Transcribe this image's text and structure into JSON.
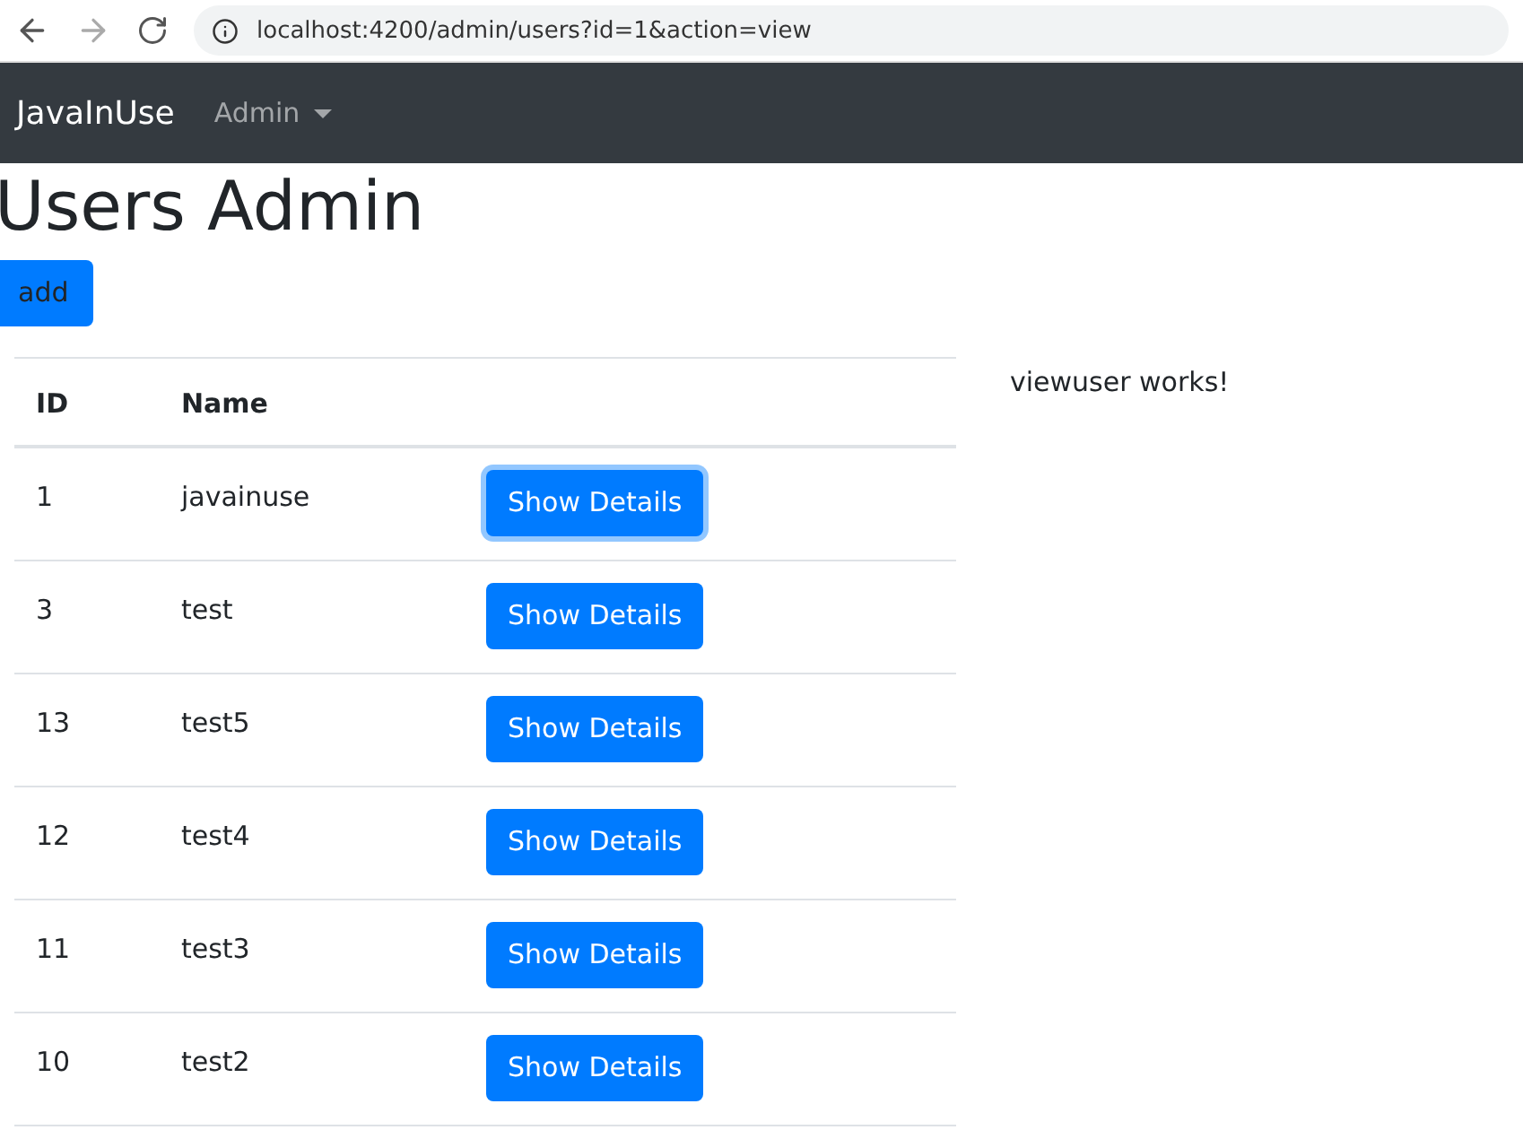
{
  "browser": {
    "url": "localhost:4200/admin/users?id=1&action=view"
  },
  "navbar": {
    "brand": "JavaInUse",
    "menu": {
      "label": "Admin",
      "expanded": false
    }
  },
  "title": "Users Admin",
  "add_button": "add",
  "table": {
    "columns": [
      "ID",
      "Name"
    ],
    "rows": [
      {
        "id": "1",
        "name": "javainuse",
        "button": "Show Details",
        "focused": true
      },
      {
        "id": "3",
        "name": "test",
        "button": "Show Details",
        "focused": false
      },
      {
        "id": "13",
        "name": "test5",
        "button": "Show Details",
        "focused": false
      },
      {
        "id": "12",
        "name": "test4",
        "button": "Show Details",
        "focused": false
      },
      {
        "id": "11",
        "name": "test3",
        "button": "Show Details",
        "focused": false
      },
      {
        "id": "10",
        "name": "test2",
        "button": "Show Details",
        "focused": false
      }
    ]
  },
  "side_message": "viewuser works!"
}
